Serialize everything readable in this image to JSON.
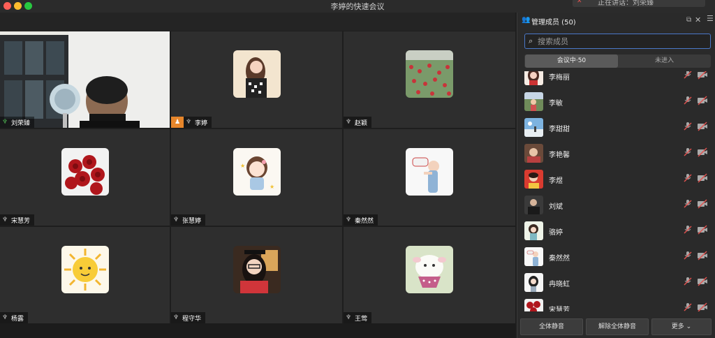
{
  "window": {
    "title": "李婷的快速会议",
    "top_notice": "正在讲话：刘荣臻"
  },
  "tiles": [
    {
      "name": "刘荣臻",
      "mic": "mic-on-icon",
      "active": true,
      "host": false
    },
    {
      "name": "李婷",
      "mic": "mic-off-icon",
      "active": false,
      "host": true
    },
    {
      "name": "赵颖",
      "mic": "mic-off-icon",
      "active": false,
      "host": false
    },
    {
      "name": "宋慧芳",
      "mic": "mic-off-icon",
      "active": false,
      "host": false
    },
    {
      "name": "张慧婷",
      "mic": "mic-off-icon",
      "active": false,
      "host": false
    },
    {
      "name": "秦然然",
      "mic": "mic-off-icon",
      "active": false,
      "host": false
    },
    {
      "name": "杨露",
      "mic": "mic-off-icon",
      "active": false,
      "host": false
    },
    {
      "name": "程守华",
      "mic": "mic-off-icon",
      "active": false,
      "host": false
    },
    {
      "name": "王莺",
      "mic": "mic-off-icon",
      "active": false,
      "host": false
    }
  ],
  "panel": {
    "title": "管理成员 (50)",
    "search_placeholder": "搜索成员",
    "tabs": {
      "in_meeting": "会议中·50",
      "not_joined": "未进入"
    },
    "members": [
      {
        "name": "李梅丽"
      },
      {
        "name": "李敏"
      },
      {
        "name": "李甜甜"
      },
      {
        "name": "李艳馨"
      },
      {
        "name": "李煜"
      },
      {
        "name": "刘斌"
      },
      {
        "name": "骆婷"
      },
      {
        "name": "秦然然"
      },
      {
        "name": "冉晓虹"
      },
      {
        "name": "宋慧芳"
      }
    ],
    "footer": {
      "mute_all": "全体静音",
      "unmute_all": "解除全体静音",
      "more": "更多"
    }
  },
  "colors": {
    "active_border": "#4caf50",
    "host_badge": "#e7862b",
    "muted_red": "#e0524f",
    "search_border": "#4a78c8"
  }
}
